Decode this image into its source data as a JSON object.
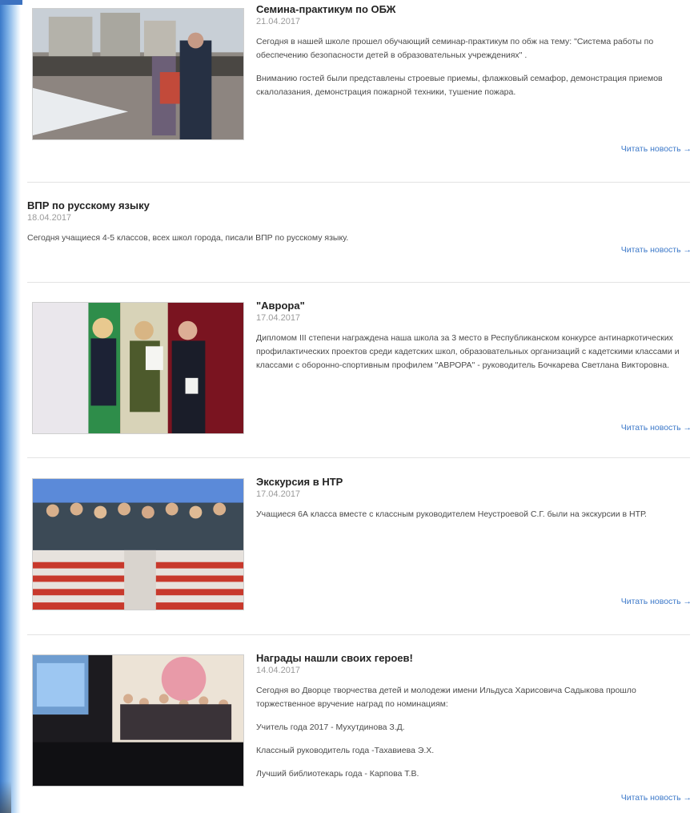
{
  "news": [
    {
      "title": "Семина-практикум по ОБЖ",
      "date": "21.04.2017",
      "paragraphs": [
        "Сегодня в нашей школе прошел обучающий семинар-практикум по обж на тему: \"Система работы по обеспечению безопасности детей в образовательных учреждениях\" .",
        "Вниманию гостей были представлены строевые приемы, флажковый семафор, демонстрация приемов скалолазания, демонстрация пожарной техники, тушение пожара."
      ]
    },
    {
      "title": "ВПР по русскому языку",
      "date": "18.04.2017",
      "paragraphs": [
        "Сегодня учащиеся 4-5 классов, всех школ города, писали ВПР по русскому языку."
      ]
    },
    {
      "title": "\"Аврора\"",
      "date": "17.04.2017",
      "paragraphs": [
        "Дипломом III степени награждена наша школа за 3 место в Республиканском конкурсе антинаркотических профилактических проектов среди кадетских школ, образовательных организаций с кадетскими классами и классами с оборонно-спортивным профилем \"АВРОРА\" - руководитель Бочкарева Светлана Викторовна."
      ]
    },
    {
      "title": "Экскурсия в НТР",
      "date": "17.04.2017",
      "paragraphs": [
        "Учащиеся 6А класса вместе с классным руководителем Неустроевой С.Г. были на экскурсии в НТР."
      ]
    },
    {
      "title": "Награды нашли своих героев!",
      "date": "14.04.2017",
      "paragraphs": [
        "Сегодня во Дворце творчества детей и молодежи имени Ильдуса Харисовича Садыкова прошло торжественное вручение наград по номинациям:",
        "Учитель года 2017 - Мухутдинова З.Д.",
        "Классный руководитель года -Тахавиева Э.Х.",
        "Лучший библиотекарь года - Карпова Т.В."
      ]
    }
  ],
  "read_more_label": "Читать новость →",
  "colors": {
    "link": "#3d79c9",
    "date": "#9a9a9a",
    "side_gradient": "#3a79c9"
  }
}
